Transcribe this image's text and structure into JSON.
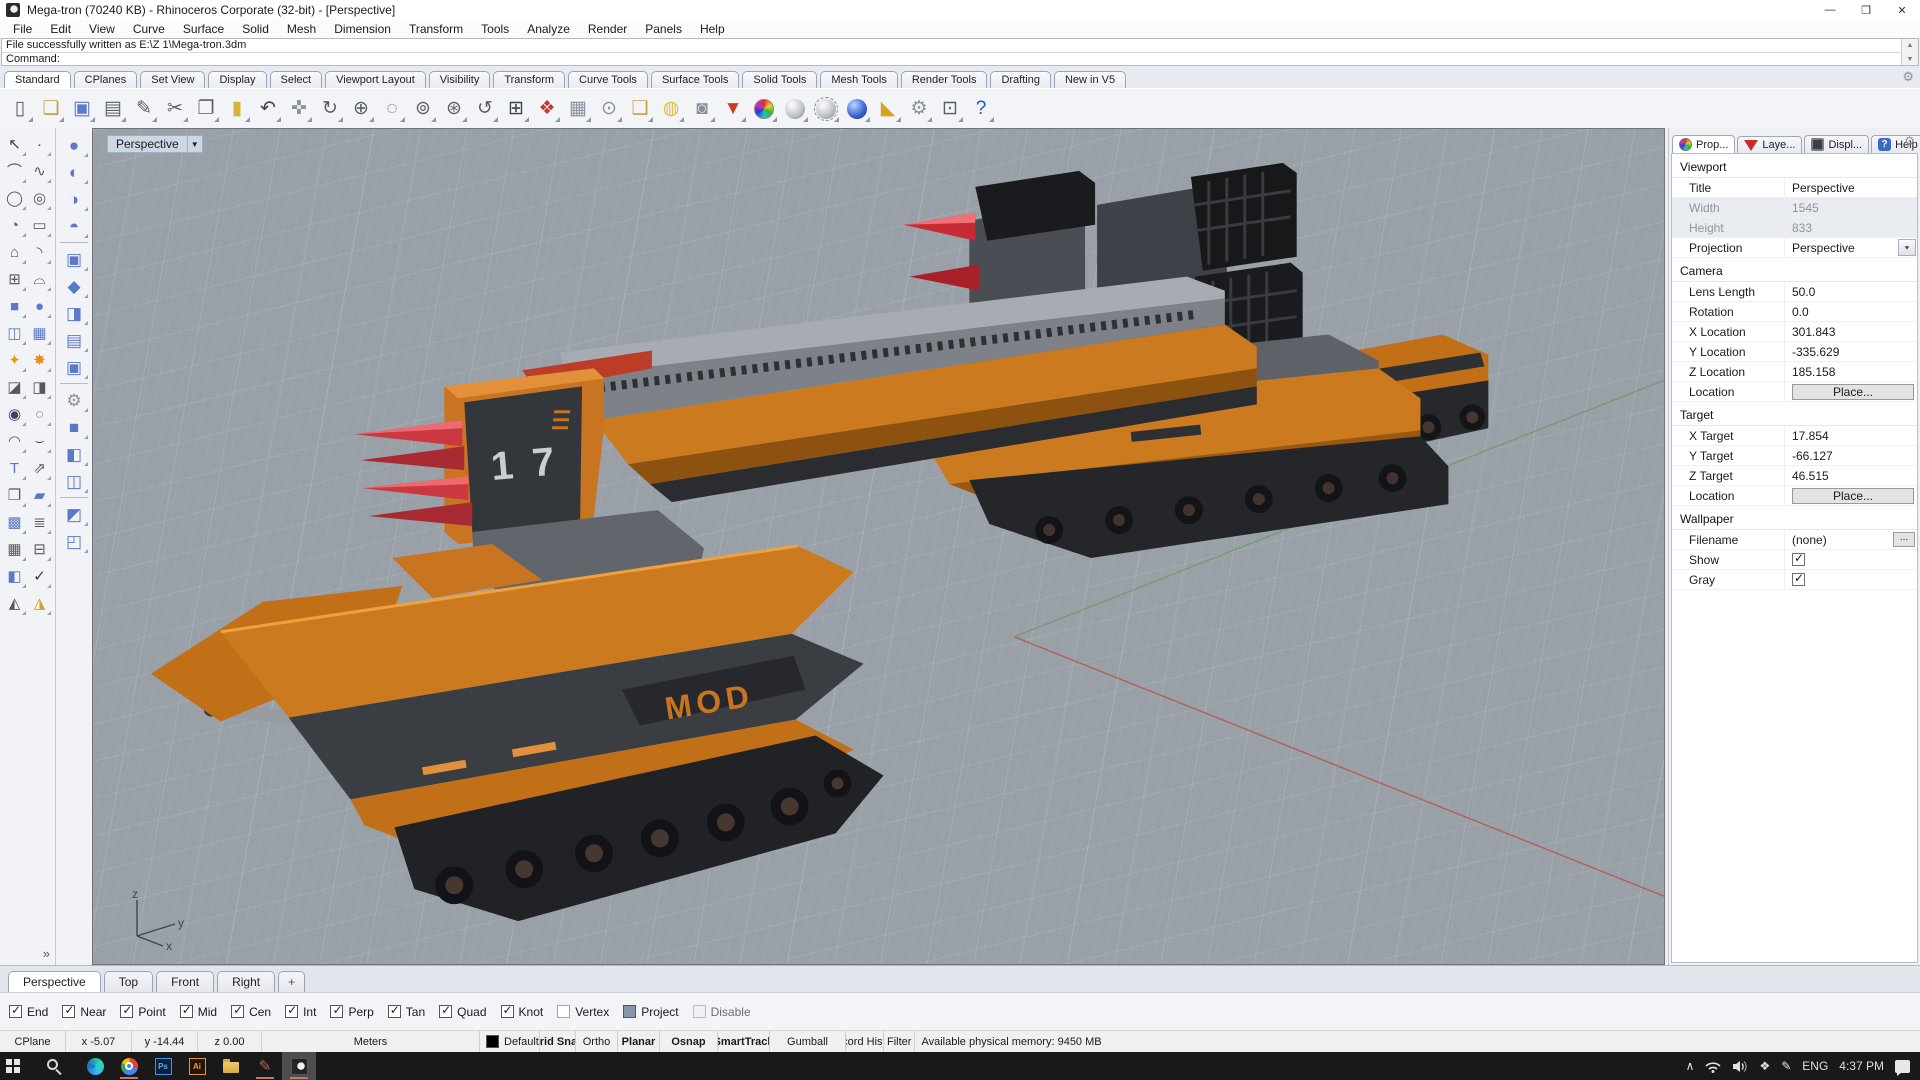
{
  "title_bar": {
    "title": "Mega-tron (70240 KB) - Rhinoceros Corporate (32-bit) - [Perspective]"
  },
  "menu": {
    "items": [
      {
        "t": "File"
      },
      {
        "t": "Edit"
      },
      {
        "t": "View"
      },
      {
        "t": "Curve"
      },
      {
        "t": "Surface"
      },
      {
        "t": "Solid"
      },
      {
        "t": "Mesh"
      },
      {
        "t": "Dimension"
      },
      {
        "t": "Transform"
      },
      {
        "t": "Tools"
      },
      {
        "t": "Analyze"
      },
      {
        "t": "Render"
      },
      {
        "t": "Panels"
      },
      {
        "t": "Help"
      }
    ]
  },
  "command": {
    "history": "File successfully written as E:\\Z 1\\Mega-tron.3dm",
    "prompt": "Command:"
  },
  "toolbar_tabs": {
    "items": [
      {
        "t": "Standard",
        "cls": "active"
      },
      {
        "t": "CPlanes"
      },
      {
        "t": "Set View"
      },
      {
        "t": "Display"
      },
      {
        "t": "Select"
      },
      {
        "t": "Viewport Layout"
      },
      {
        "t": "Visibility"
      },
      {
        "t": "Transform"
      },
      {
        "t": "Curve Tools"
      },
      {
        "t": "Surface Tools"
      },
      {
        "t": "Solid Tools"
      },
      {
        "t": "Mesh Tools"
      },
      {
        "t": "Render Tools"
      },
      {
        "t": "Drafting"
      },
      {
        "t": "New in V5"
      }
    ]
  },
  "toolbar": {
    "icons": [
      {
        "g": "▯",
        "c": "#5a6068"
      },
      {
        "g": "❏",
        "c": "#c89b3c"
      },
      {
        "g": "▣",
        "c": "#5b79c8"
      },
      {
        "g": "▤",
        "c": "#5a6068"
      },
      {
        "g": "✎",
        "c": "#5a6068"
      },
      {
        "g": "✂",
        "c": "#5a6068"
      },
      {
        "g": "❐",
        "c": "#5a6068"
      },
      {
        "g": "▮",
        "c": "#d8b33c"
      },
      {
        "g": "↶",
        "c": "#3c4250"
      },
      {
        "g": "✜",
        "c": "#88909c"
      },
      {
        "g": "↻",
        "c": "#5a6068"
      },
      {
        "g": "⊕",
        "c": "#5a6068"
      },
      {
        "g": "◌",
        "c": "#5a6068"
      },
      {
        "g": "⊚",
        "c": "#5a6068"
      },
      {
        "g": "⊛",
        "c": "#5a6068"
      },
      {
        "g": "↺",
        "c": "#5a6068"
      },
      {
        "g": "⊞",
        "c": "#3c4250"
      },
      {
        "g": "❖",
        "c": "#c23a2c"
      },
      {
        "g": "▦",
        "c": "#88909c"
      },
      {
        "g": "⊙",
        "c": "#88909c"
      },
      {
        "g": "❑",
        "c": "#c8a23c"
      },
      {
        "g": "◍",
        "c": "#d8c040"
      },
      {
        "g": "◙",
        "c": "#88909c"
      },
      {
        "g": "▼",
        "c": "#c8402c"
      },
      {
        "cls": "wheel"
      },
      {
        "cls": "sphere-gray"
      },
      {
        "cls": "sphere-dash"
      },
      {
        "cls": "sphere-blue"
      },
      {
        "g": "◣",
        "c": "#d8a020"
      },
      {
        "g": "⚙",
        "c": "#88909c"
      },
      {
        "g": "⊡",
        "c": "#5a6068"
      },
      {
        "g": "?",
        "c": "#2858c8"
      }
    ]
  },
  "sidebar": {
    "main_icons": [
      {
        "g": "↖",
        "c": "#3c4046"
      },
      {
        "g": "·",
        "c": "#3c4046"
      },
      {
        "g": "⌒"
      },
      {
        "g": "∿"
      },
      {
        "g": "◯"
      },
      {
        "g": "◎"
      },
      {
        "g": "◔"
      },
      {
        "g": "▭"
      },
      {
        "g": "⌂"
      },
      {
        "g": "◝"
      },
      {
        "g": "⊞"
      },
      {
        "g": "⌓"
      },
      {
        "g": "■",
        "c": "#5b79c8"
      },
      {
        "g": "●",
        "c": "#5b79c8"
      },
      {
        "g": "◫",
        "c": "#5b79c8"
      },
      {
        "g": "▦",
        "c": "#5b79c8"
      },
      {
        "g": "✦",
        "c": "#d8a020"
      },
      {
        "g": "✸",
        "c": "#e8901c"
      },
      {
        "g": "◪"
      },
      {
        "g": "◨"
      },
      {
        "g": "◉",
        "c": "#404070"
      },
      {
        "g": "○",
        "c": "#8888b8"
      },
      {
        "g": "◠"
      },
      {
        "g": "⌣"
      },
      {
        "g": "T",
        "c": "#5b79c8"
      },
      {
        "g": "⇗"
      },
      {
        "g": "❒"
      },
      {
        "g": "▰",
        "c": "#5b79c8"
      },
      {
        "g": "▩",
        "c": "#5b79c8"
      },
      {
        "g": "≣"
      },
      {
        "g": "▦"
      },
      {
        "g": "⊟"
      },
      {
        "g": "◧",
        "c": "#5b79c8"
      },
      {
        "g": "✓",
        "c": "#3c4046"
      },
      {
        "g": "◭"
      },
      {
        "g": "◮",
        "c": "#d8a020"
      }
    ],
    "side_icons": [
      {
        "g": "●"
      },
      {
        "g": "◐"
      },
      {
        "g": "◑"
      },
      {
        "g": "◓"
      },
      {
        "cls": "sep"
      },
      {
        "g": "▣"
      },
      {
        "g": "◆"
      },
      {
        "g": "◨"
      },
      {
        "g": "▤"
      },
      {
        "g": "▣"
      },
      {
        "cls": "sep"
      },
      {
        "g": "⚙",
        "c": "#8a9098"
      },
      {
        "g": "■"
      },
      {
        "g": "◧"
      },
      {
        "g": "◫"
      },
      {
        "cls": "sep"
      },
      {
        "g": "◩"
      },
      {
        "g": "◰"
      }
    ],
    "more": "»"
  },
  "viewport": {
    "label": "Perspective",
    "axis": {
      "x": "x",
      "y": "y",
      "z": "z"
    },
    "model": {
      "number": "1 7",
      "name": "MOD"
    }
  },
  "right_panel": {
    "tabs": {
      "prop": "Prop...",
      "layers": "Laye...",
      "display": "Displ...",
      "help": "Help"
    },
    "viewport_section": {
      "header": "Viewport",
      "title_label": "Title",
      "title_value": "Perspective",
      "width_label": "Width",
      "width_value": "1545",
      "height_label": "Height",
      "height_value": "833",
      "projection_label": "Projection",
      "projection_value": "Perspective"
    },
    "camera_section": {
      "header": "Camera",
      "lens_label": "Lens Length",
      "lens_value": "50.0",
      "rotation_label": "Rotation",
      "rotation_value": "0.0",
      "x_label": "X Location",
      "x_value": "301.843",
      "y_label": "Y Location",
      "y_value": "-335.629",
      "z_label": "Z Location",
      "z_value": "185.158",
      "location_label": "Location",
      "place_button": "Place..."
    },
    "target_section": {
      "header": "Target",
      "x_label": "X Target",
      "x_value": "17.854",
      "y_label": "Y Target",
      "y_value": "-66.127",
      "z_label": "Z Target",
      "z_value": "46.515",
      "location_label": "Location",
      "place_button": "Place..."
    },
    "wallpaper_section": {
      "header": "Wallpaper",
      "filename_label": "Filename",
      "filename_value": "(none)",
      "show_label": "Show",
      "gray_label": "Gray"
    }
  },
  "vp_tabs": {
    "items": [
      {
        "t": "Perspective",
        "cls": "active"
      },
      {
        "t": "Top"
      },
      {
        "t": "Front"
      },
      {
        "t": "Right"
      },
      {
        "t": "+",
        "cls": "plus"
      }
    ]
  },
  "osnap": {
    "items": [
      {
        "t": "End",
        "s": "checked"
      },
      {
        "t": "Near",
        "s": "checked"
      },
      {
        "t": "Point",
        "s": "checked"
      },
      {
        "t": "Mid",
        "s": "checked"
      },
      {
        "t": "Cen",
        "s": "checked"
      },
      {
        "t": "Int",
        "s": "checked"
      },
      {
        "t": "Perp",
        "s": "checked"
      },
      {
        "t": "Tan",
        "s": "checked"
      },
      {
        "t": "Quad",
        "s": "checked"
      },
      {
        "t": "Knot",
        "s": "checked"
      },
      {
        "t": "Vertex",
        "s": "off"
      },
      {
        "t": "Project",
        "s": "filled"
      },
      {
        "t": "Disable",
        "s": "off",
        "dim": "dim"
      }
    ]
  },
  "status": {
    "cells": [
      {
        "t": "CPlane"
      },
      {
        "t": "x -5.07"
      },
      {
        "t": "y -14.44"
      },
      {
        "t": "z 0.00"
      },
      {
        "t": "Meters"
      },
      {
        "t": "Default",
        "cls": "swatch"
      },
      {
        "t": "Grid Snap",
        "cls": "bold"
      },
      {
        "t": "Ortho"
      },
      {
        "t": "Planar",
        "cls": "bold"
      },
      {
        "t": "Osnap",
        "cls": "bold"
      },
      {
        "t": "SmartTrack",
        "cls": "bold"
      },
      {
        "t": "Gumball"
      },
      {
        "t": "Record History"
      },
      {
        "t": "Filter"
      },
      {
        "t": "Available physical memory: 9450 MB",
        "cls": "mem"
      }
    ]
  },
  "taskbar": {
    "ps": "Ps",
    "ai": "Ai",
    "chevron": "∧",
    "dropbox": "❖",
    "pen": "✎",
    "lang": "ENG",
    "time": "4:37 PM"
  }
}
